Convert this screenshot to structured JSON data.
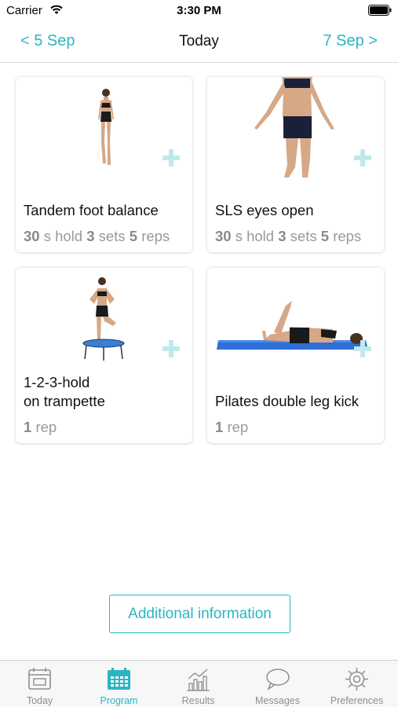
{
  "status_bar": {
    "carrier": "Carrier",
    "time": "3:30 PM"
  },
  "nav": {
    "prev_label": "< 5 Sep",
    "title": "Today",
    "next_label": "7 Sep >"
  },
  "exercises": [
    {
      "title": "Tandem foot balance",
      "meta": {
        "hold_value": "30",
        "hold_unit": "s hold",
        "sets_value": "3",
        "sets_unit": "sets",
        "reps_value": "5",
        "reps_unit": "reps"
      }
    },
    {
      "title": "SLS eyes open",
      "meta": {
        "hold_value": "30",
        "hold_unit": "s hold",
        "sets_value": "3",
        "sets_unit": "sets",
        "reps_value": "5",
        "reps_unit": "reps"
      }
    },
    {
      "title": "1-2-3-hold\non trampette",
      "meta": {
        "reps_value": "1",
        "reps_unit": "rep"
      }
    },
    {
      "title": "Pilates double leg kick",
      "meta": {
        "reps_value": "1",
        "reps_unit": "rep"
      }
    }
  ],
  "additional_button": {
    "label": "Additional information"
  },
  "tabs": [
    {
      "label": "Today",
      "icon": "calendar-day-icon",
      "active": false
    },
    {
      "label": "Program",
      "icon": "calendar-grid-icon",
      "active": true
    },
    {
      "label": "Results",
      "icon": "bar-chart-icon",
      "active": false
    },
    {
      "label": "Messages",
      "icon": "speech-bubble-icon",
      "active": false
    },
    {
      "label": "Preferences",
      "icon": "gear-icon",
      "active": false
    }
  ],
  "colors": {
    "accent": "#2bb5c4",
    "plus": "#bfe9ec",
    "inactive_tab": "#8e8e8e"
  }
}
